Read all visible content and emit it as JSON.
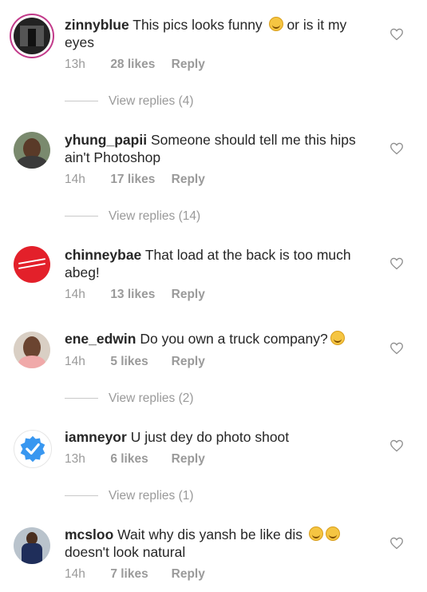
{
  "comments": [
    {
      "username": "zinnyblue",
      "text_before": "This pics looks funny",
      "text_after": "or is it my eyes",
      "emoji": "grinning-face",
      "time": "13h",
      "likes": "28 likes",
      "reply": "Reply",
      "view_replies": "View replies (4)"
    },
    {
      "username": "yhung_papii",
      "text_before": "Someone should tell me this hips ain't Photoshop",
      "time": "14h",
      "likes": "17 likes",
      "reply": "Reply",
      "view_replies": "View replies (14)"
    },
    {
      "username": "chinneybae",
      "text_before": "That load at the back is too much abeg!",
      "time": "14h",
      "likes": "13 likes",
      "reply": "Reply"
    },
    {
      "username": "ene_edwin",
      "text_before": "Do you own a truck company?",
      "emoji": "worried-face",
      "time": "14h",
      "likes": "5 likes",
      "reply": "Reply",
      "view_replies": "View replies (2)"
    },
    {
      "username": "iamneyor",
      "text_before": "U just dey do photo shoot",
      "time": "13h",
      "likes": "6 likes",
      "reply": "Reply",
      "view_replies": "View replies (1)"
    },
    {
      "username": "mcsloo",
      "text_before": "Wait why dis yansh be like dis",
      "text_after": "doesn't look natural",
      "emoji": "rofl-face",
      "time": "14h",
      "likes": "7 likes",
      "reply": "Reply"
    }
  ],
  "colors": {
    "text": "#262626",
    "muted": "#9a9a9a",
    "verified_blue": "#3897f0",
    "chinney_red": "#e3202a"
  }
}
